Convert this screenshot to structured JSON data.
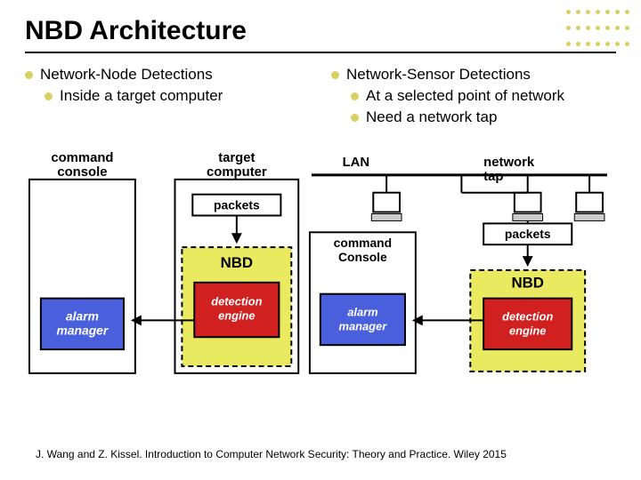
{
  "title": "NBD Architecture",
  "left": {
    "heading": "Network-Node Detections",
    "sub1": "Inside a target computer"
  },
  "right": {
    "heading": "Network-Sensor Detections",
    "sub1": "At a selected point of network",
    "sub2": "Need a network tap"
  },
  "diagram": {
    "command_console": "command console",
    "target_computer": "target computer",
    "packets": "packets",
    "nbd": "NBD",
    "alarm_manager": "alarm manager",
    "detection_engine": "detection engine",
    "lan": "LAN",
    "network_tap": "network tap",
    "command_Console": "command Console"
  },
  "credit": "J. Wang and Z. Kissel. Introduction to Computer Network Security: Theory and Practice. Wiley 2015"
}
